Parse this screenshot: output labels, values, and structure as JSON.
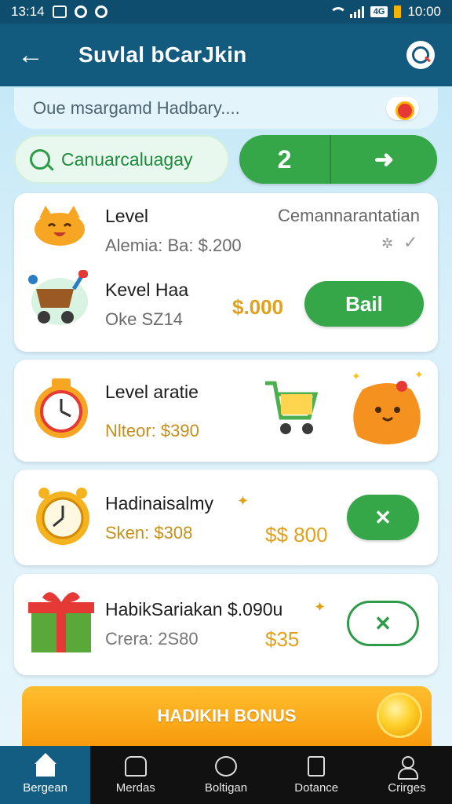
{
  "status_bar": {
    "time": "13:14",
    "clock": "10:00",
    "badge": "4G"
  },
  "app_bar": {
    "title": "Suvlal bCarJkin"
  },
  "search": {
    "placeholder": "Oue msargamd Hadbary...."
  },
  "filter": {
    "chip_label": "Canuarcaluagay",
    "count": "2",
    "go_label": "➜"
  },
  "cards": [
    {
      "title": "Level",
      "right_label": "Cemannarantatian",
      "subtitle": "Alemia: Ba: $.200",
      "item_title": "Kevel Haa",
      "item_sub": "Oke SZ14",
      "price": "$.000",
      "button": "Bail"
    },
    {
      "title": "Level aratie",
      "subtitle": "Nlteor: $390"
    },
    {
      "title": "Hadinaisalmy",
      "subtitle": "Sken: $308",
      "price": "$$ 800",
      "button": "✕"
    },
    {
      "title": "HabikSariakan $.090u",
      "subtitle": "Crera: 2S80",
      "price": "$35",
      "button": "✕"
    }
  ],
  "bonus": {
    "label": "HADIKIH BONUS"
  },
  "nav": [
    {
      "label": "Bergean",
      "icon": "home-icon"
    },
    {
      "label": "Merdas",
      "icon": "menu-icon"
    },
    {
      "label": "Boltigan",
      "icon": "bolt-icon"
    },
    {
      "label": "Dotance",
      "icon": "document-icon"
    },
    {
      "label": "Crirges",
      "icon": "user-icon"
    }
  ],
  "colors": {
    "header": "#125a7e",
    "accent_green": "#35a748",
    "price_gold": "#e0a11d",
    "bonus_orange": "#f79a0c"
  }
}
